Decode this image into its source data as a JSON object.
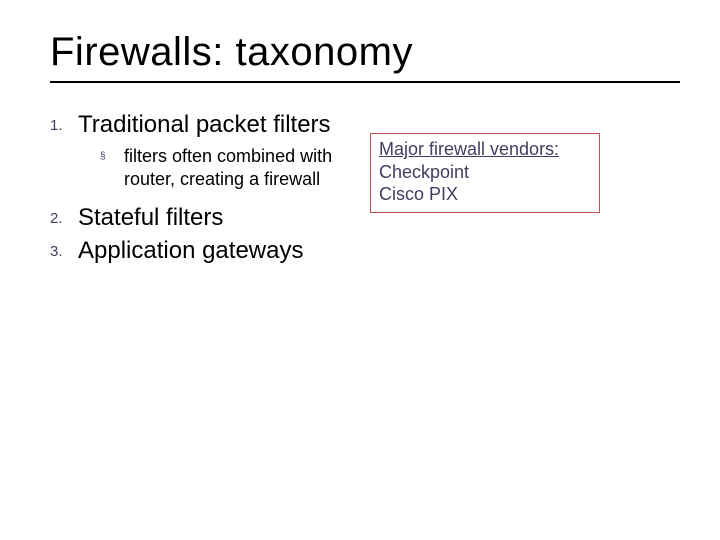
{
  "title": "Firewalls: taxonomy",
  "list": {
    "items": [
      {
        "marker": "1.",
        "text": "Traditional packet filters",
        "sub": {
          "marker": "§",
          "text": "filters often combined with  router, creating a firewall"
        }
      },
      {
        "marker": "2.",
        "text": "Stateful filters"
      },
      {
        "marker": "3.",
        "text": "Application gateways"
      }
    ]
  },
  "vendor_box": {
    "heading": "Major firewall vendors:",
    "items": [
      "Checkpoint",
      "Cisco PIX"
    ]
  }
}
